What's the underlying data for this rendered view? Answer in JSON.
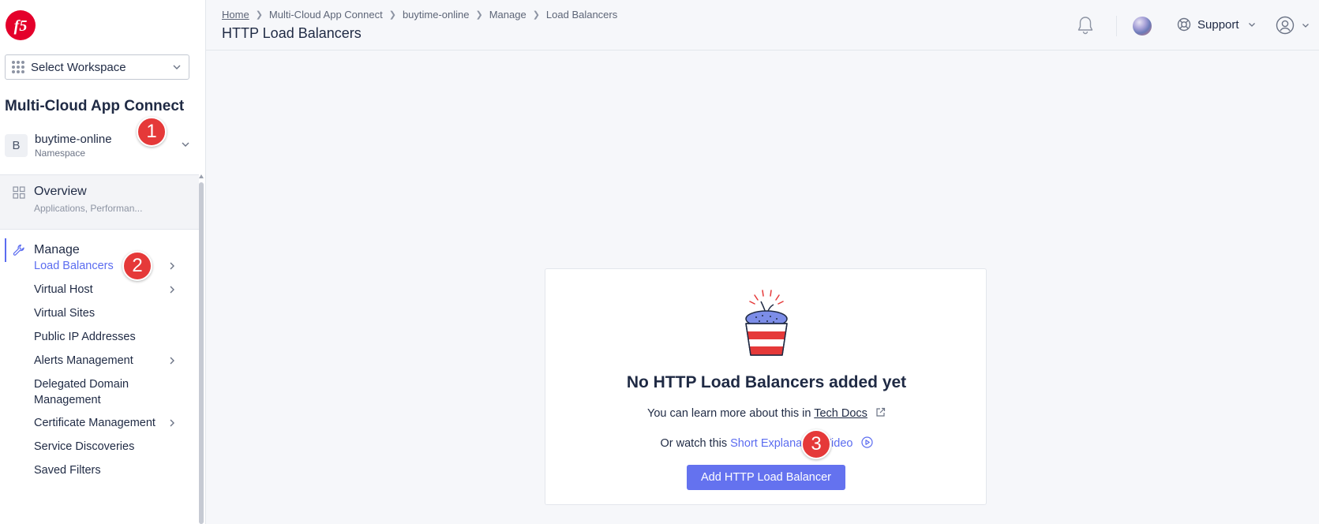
{
  "header": {
    "breadcrumb": [
      "Home",
      "Multi-Cloud App Connect",
      "buytime-online",
      "Manage",
      "Load Balancers"
    ],
    "title": "HTTP Load Balancers",
    "support_label": "Support"
  },
  "sidebar": {
    "workspace_placeholder": "Select Workspace",
    "app_title": "Multi-Cloud App Connect",
    "namespace": {
      "avatar": "B",
      "name": "buytime-online",
      "label": "Namespace"
    },
    "overview": {
      "title": "Overview",
      "subtitle": "Applications, Performan..."
    },
    "manage_label": "Manage",
    "items": [
      {
        "label": "Load Balancers",
        "active": true,
        "has_submenu": true
      },
      {
        "label": "Virtual Host",
        "has_submenu": true
      },
      {
        "label": "Virtual Sites",
        "has_submenu": false
      },
      {
        "label": "Public IP Addresses",
        "has_submenu": false
      },
      {
        "label": "Alerts Management",
        "has_submenu": true
      },
      {
        "label": "Delegated Domain Management",
        "has_submenu": false
      },
      {
        "label": "Certificate Management",
        "has_submenu": true
      },
      {
        "label": "Service Discoveries",
        "has_submenu": false
      },
      {
        "label": "Saved Filters",
        "has_submenu": false
      }
    ]
  },
  "empty_state": {
    "title": "No HTTP Load Balancers added yet",
    "learn_prefix": "You can learn more about this in",
    "learn_link": "Tech Docs",
    "watch_prefix": "Or watch this",
    "watch_link": "Short Explanation Video",
    "button": "Add HTTP Load Balancer"
  },
  "annotations": [
    "1",
    "2",
    "3"
  ],
  "colors": {
    "accent": "#5b6cf0",
    "badge": "#e53939",
    "button": "#6472ef"
  }
}
